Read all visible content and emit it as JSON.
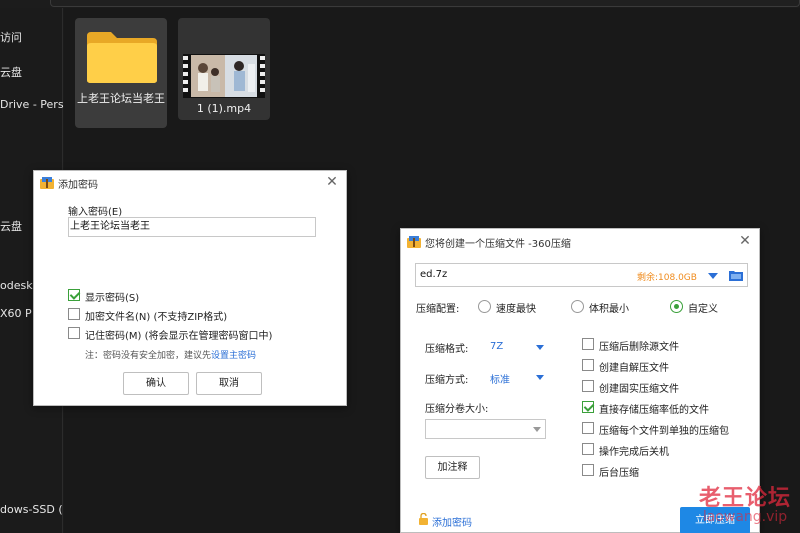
{
  "explorer": {
    "sidebar_items": [
      "访问",
      "云盘",
      "Drive - Person",
      "",
      "",
      "",
      "云盘",
      "",
      "odesk",
      "X60 P",
      "",
      "",
      "",
      "",
      "",
      "",
      "dows-SSD ("
    ],
    "files": [
      {
        "name": "上老王论坛当老王",
        "icon": "folder-icon"
      },
      {
        "name": "1 (1).mp4",
        "icon": "video-thumbnail"
      }
    ]
  },
  "password_dialog": {
    "title": "添加密码",
    "input_label": "输入密码(E)",
    "input_value": "上老王论坛当老王",
    "show_password": "显示密码(S)",
    "show_password_checked": true,
    "encrypt_names": "加密文件名(N) (不支持ZIP格式)",
    "encrypt_names_checked": false,
    "remember": "记住密码(M) (将会显示在管理密码窗口中)",
    "remember_checked": false,
    "note_prefix": "注：密码没有安全加密，建议先",
    "note_link": "设置主密码",
    "ok": "确认",
    "cancel": "取消"
  },
  "compress_dialog": {
    "title": "您将创建一个压缩文件 -360压缩",
    "path_value": "ed.7z",
    "free_space": "剩余:108.0GB",
    "config_label": "压缩配置:",
    "presets": [
      {
        "label": "速度最快",
        "selected": false
      },
      {
        "label": "体积最小",
        "selected": false
      },
      {
        "label": "自定义",
        "selected": true
      }
    ],
    "format_label": "压缩格式:",
    "format_value": "7Z",
    "method_label": "压缩方式:",
    "method_value": "标准",
    "volume_label": "压缩分卷大小:",
    "volume_value": "",
    "comment_button": "加注释",
    "options": [
      {
        "label": "压缩后删除源文件",
        "checked": false
      },
      {
        "label": "创建自解压文件",
        "checked": false
      },
      {
        "label": "创建固实压缩文件",
        "checked": false
      },
      {
        "label": "直接存储压缩率低的文件",
        "checked": true
      },
      {
        "label": "压缩每个文件到单独的压缩包",
        "checked": false
      },
      {
        "label": "操作完成后关机",
        "checked": false
      },
      {
        "label": "后台压缩",
        "checked": false
      }
    ],
    "add_password_link": "添加密码",
    "start_button": "立即压缩"
  },
  "watermark": {
    "line1": "老王论坛",
    "line2": "laowang.vip"
  },
  "colors": {
    "accent_green": "#3aa03a",
    "link_blue": "#2b6fd6",
    "free_space_orange": "#f08c1e",
    "primary_button": "#1e88e5",
    "watermark_red": "#e0283c"
  }
}
